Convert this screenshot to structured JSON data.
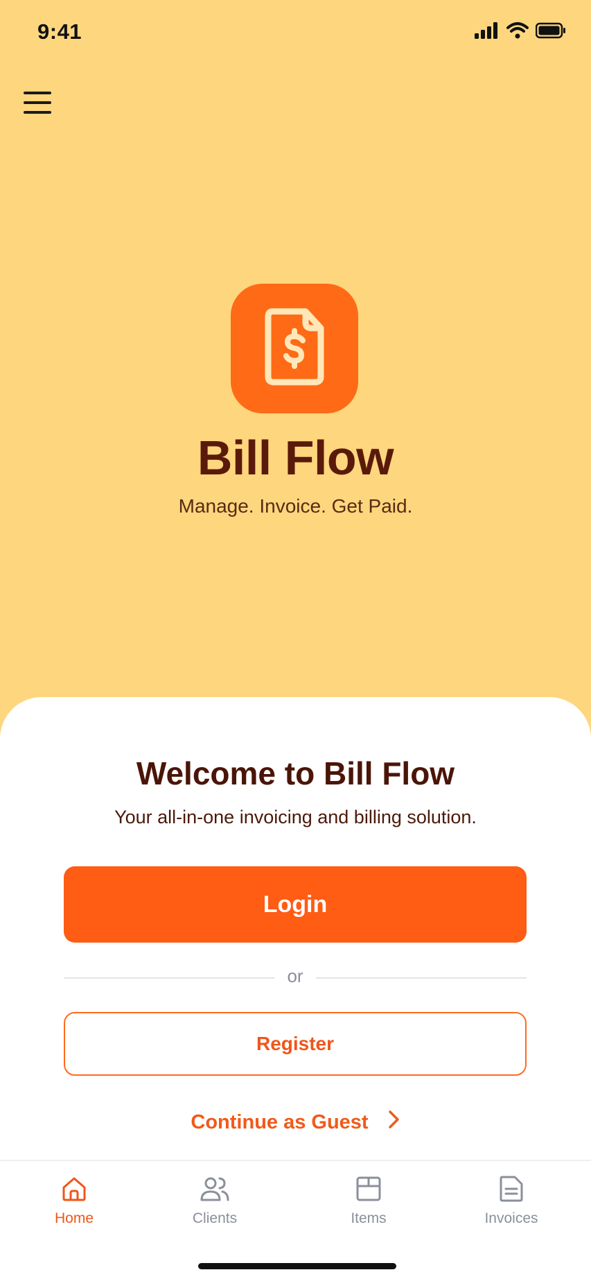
{
  "status_bar": {
    "time": "9:41"
  },
  "brand": {
    "name": "Bill Flow",
    "tagline": "Manage. Invoice. Get Paid.",
    "accent_color": "#FF6A16",
    "background_color": "#FDD67E"
  },
  "welcome": {
    "title": "Welcome to Bill Flow",
    "subtitle": "Your all-in-one invoicing and billing solution."
  },
  "actions": {
    "login_label": "Login",
    "divider_label": "or",
    "register_label": "Register",
    "guest_label": "Continue as Guest"
  },
  "nav": {
    "active": "home",
    "items": [
      {
        "label": "Home",
        "icon": "home-icon"
      },
      {
        "label": "Clients",
        "icon": "users-icon"
      },
      {
        "label": "Items",
        "icon": "box-icon"
      },
      {
        "label": "Invoices",
        "icon": "document-icon"
      }
    ]
  }
}
